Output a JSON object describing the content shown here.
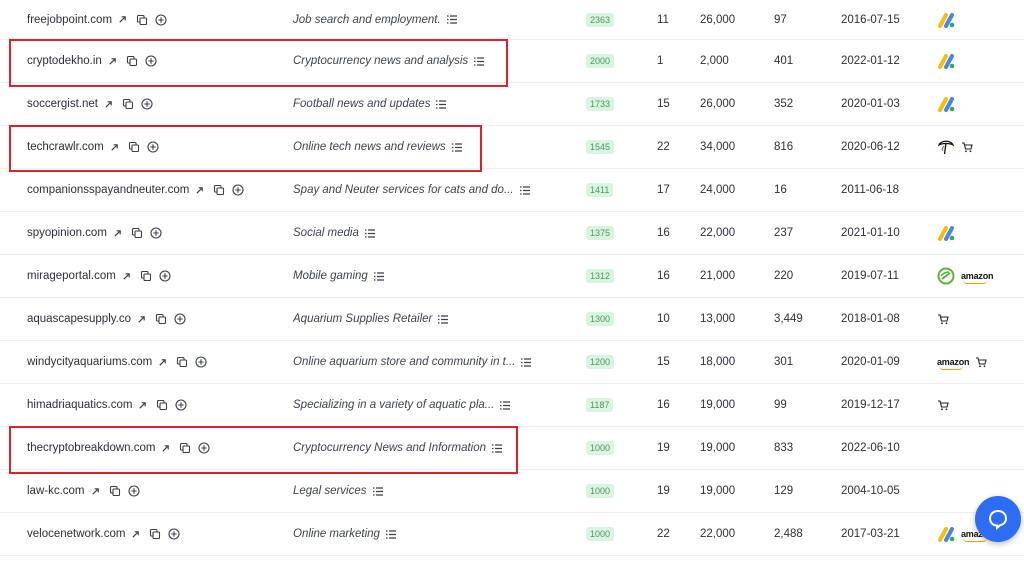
{
  "rows": [
    {
      "domain": "freejobpoint.com",
      "description": "Job search and employment.",
      "dr": "2363",
      "n1": "11",
      "n2": "26,000",
      "n3": "97",
      "date": "2016-07-15",
      "icons": [
        "adsense"
      ]
    },
    {
      "domain": "cryptodekho.in",
      "description": "Cryptocurrency news and analysis",
      "dr": "2000",
      "n1": "1",
      "n2": "2,000",
      "n3": "401",
      "date": "2022-01-12",
      "icons": [
        "adsense"
      ]
    },
    {
      "domain": "soccergist.net",
      "description": "Football news and updates",
      "dr": "1733",
      "n1": "15",
      "n2": "26,000",
      "n3": "352",
      "date": "2020-01-03",
      "icons": [
        "adsense"
      ]
    },
    {
      "domain": "techcrawlr.com",
      "description": "Online tech news and reviews",
      "dr": "1545",
      "n1": "22",
      "n2": "34,000",
      "n3": "816",
      "date": "2020-06-12",
      "icons": [
        "tree",
        "cart"
      ]
    },
    {
      "domain": "companionsspayandneuter.com",
      "description": "Spay and Neuter services for cats and do...",
      "dr": "1411",
      "n1": "17",
      "n2": "24,000",
      "n3": "16",
      "date": "2011-06-18",
      "icons": []
    },
    {
      "domain": "spyopinion.com",
      "description": "Social media",
      "dr": "1375",
      "n1": "16",
      "n2": "22,000",
      "n3": "237",
      "date": "2021-01-10",
      "icons": [
        "adsense"
      ]
    },
    {
      "domain": "mirageportal.com",
      "description": "Mobile gaming",
      "dr": "1312",
      "n1": "16",
      "n2": "21,000",
      "n3": "220",
      "date": "2019-07-11",
      "icons": [
        "green-circle",
        "amazon"
      ]
    },
    {
      "domain": "aquascapesupply.co",
      "description": "Aquarium Supplies Retailer",
      "dr": "1300",
      "n1": "10",
      "n2": "13,000",
      "n3": "3,449",
      "date": "2018-01-08",
      "icons": [
        "cart"
      ]
    },
    {
      "domain": "windycityaquariums.com",
      "description": "Online aquarium store and community in t...",
      "dr": "1200",
      "n1": "15",
      "n2": "18,000",
      "n3": "301",
      "date": "2020-01-09",
      "icons": [
        "amazon",
        "cart"
      ]
    },
    {
      "domain": "himadriaquatics.com",
      "description": "Specializing in a variety of aquatic pla...",
      "dr": "1187",
      "n1": "16",
      "n2": "19,000",
      "n3": "99",
      "date": "2019-12-17",
      "icons": [
        "cart"
      ]
    },
    {
      "domain": "thecryptobreakdown.com",
      "description": "Cryptocurrency News and Information",
      "dr": "1000",
      "n1": "19",
      "n2": "19,000",
      "n3": "833",
      "date": "2022-06-10",
      "icons": []
    },
    {
      "domain": "law-kc.com",
      "description": "Legal services",
      "dr": "1000",
      "n1": "19",
      "n2": "19,000",
      "n3": "129",
      "date": "2004-10-05",
      "icons": []
    },
    {
      "domain": "velocenetwork.com",
      "description": "Online marketing",
      "dr": "1000",
      "n1": "22",
      "n2": "22,000",
      "n3": "2,488",
      "date": "2017-03-21",
      "icons": [
        "adsense",
        "amazon",
        "cart"
      ]
    }
  ],
  "icon_labels": {
    "amazon": "amazon"
  },
  "colors": {
    "highlight": "#e0202a",
    "badge_bg": "#d7f5df",
    "chat": "#2d6df6"
  }
}
